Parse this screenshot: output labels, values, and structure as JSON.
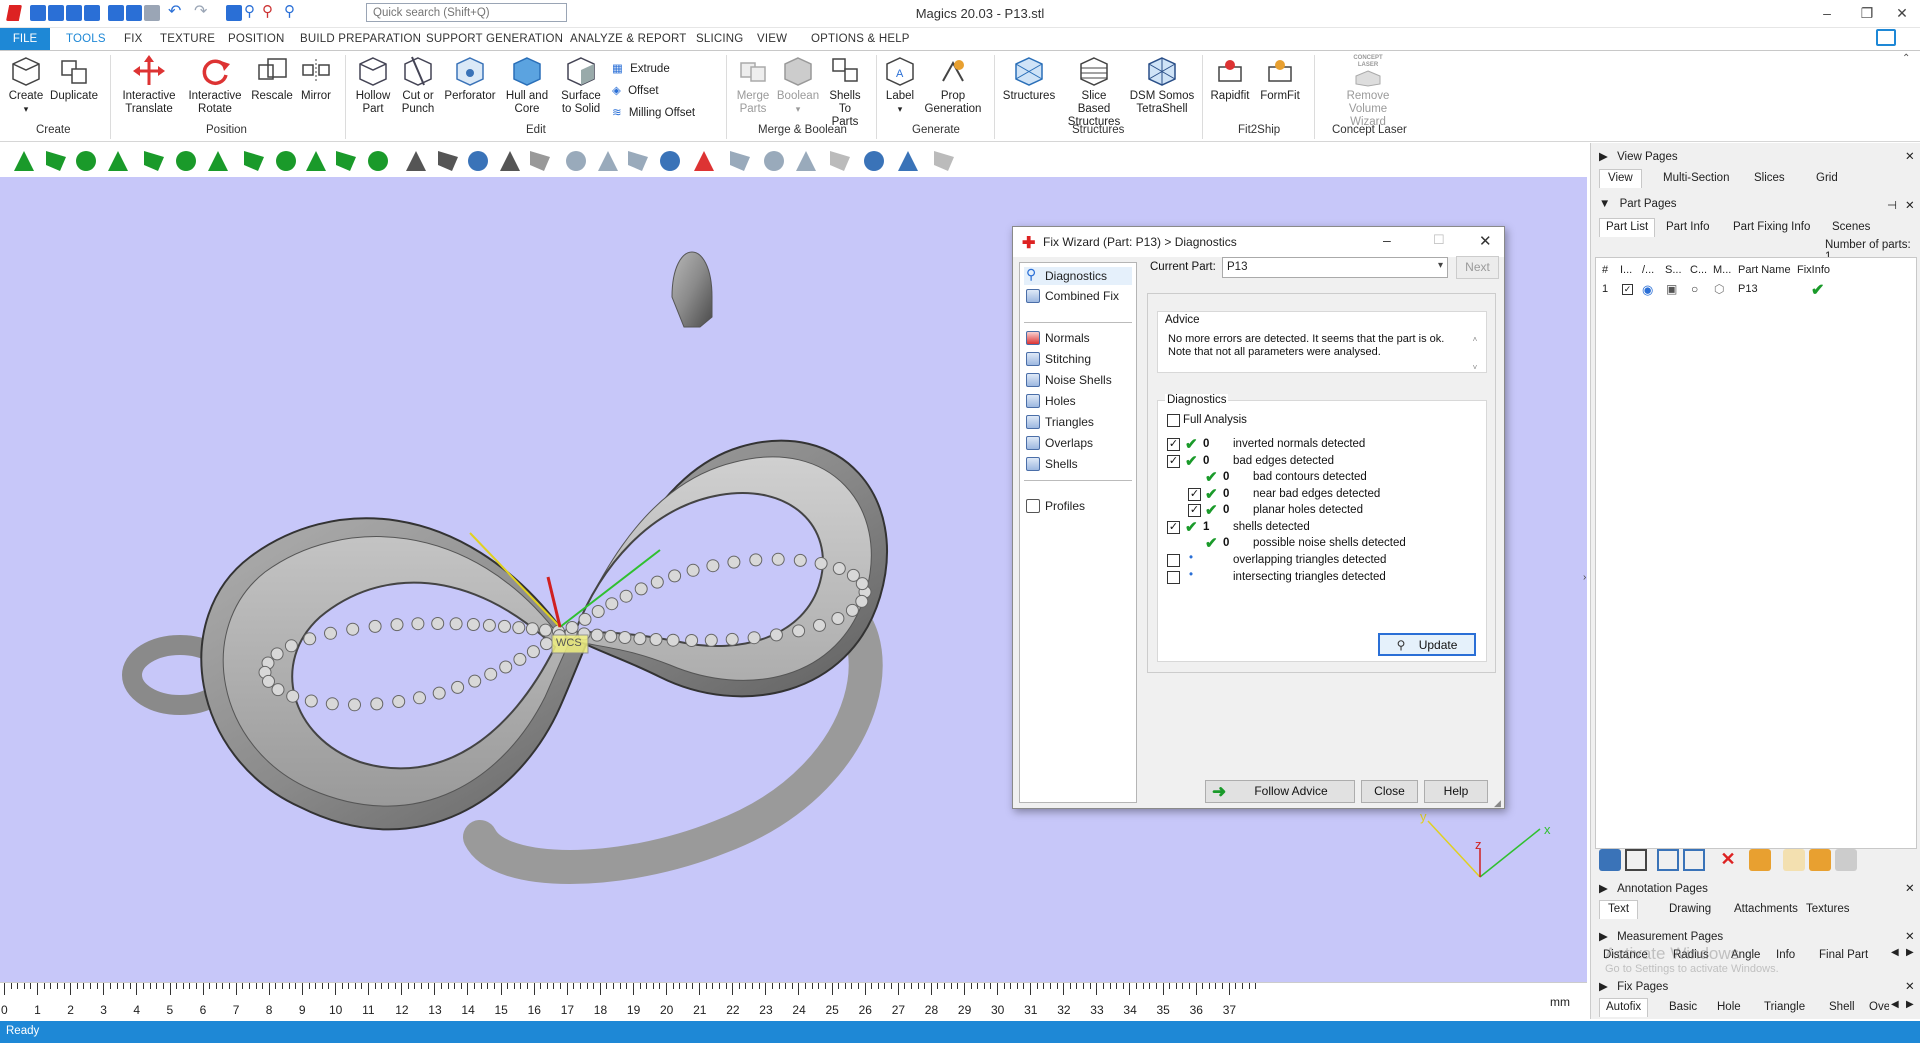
{
  "app": {
    "title": "Magics 20.03 - P13.stl",
    "search_placeholder": "Quick search (Shift+Q)"
  },
  "menu": {
    "tabs": [
      "FILE",
      "TOOLS",
      "FIX",
      "TEXTURE",
      "POSITION",
      "BUILD PREPARATION",
      "SUPPORT GENERATION",
      "ANALYZE & REPORT",
      "SLICING",
      "VIEW",
      "OPTIONS & HELP"
    ]
  },
  "ribbon": {
    "create": {
      "group": "Create",
      "create": "Create",
      "duplicate": "Duplicate"
    },
    "position": {
      "group": "Position",
      "translate": "Interactive Translate",
      "rotate": "Interactive Rotate",
      "rescale": "Rescale",
      "mirror": "Mirror"
    },
    "edit": {
      "group": "Edit",
      "hollow": "Hollow Part",
      "cut": "Cut or Punch",
      "perforator": "Perforator",
      "hull": "Hull and Core",
      "surface": "Surface to Solid",
      "extrude": "Extrude",
      "offset": "Offset",
      "milling": "Milling Offset"
    },
    "merge": {
      "group": "Merge & Boolean",
      "merge": "Merge Parts",
      "boolean": "Boolean",
      "shells": "Shells To Parts"
    },
    "generate": {
      "group": "Generate",
      "label": "Label",
      "prop": "Prop Generation"
    },
    "structures": {
      "group": "Structures",
      "structures": "Structures",
      "slice": "Slice Based Structures",
      "dsm": "DSM Somos TetraShell"
    },
    "fit2ship": {
      "group": "Fit2Ship",
      "rapidfit": "Rapidfit",
      "formfit": "FormFit"
    },
    "concept": {
      "group": "Concept Laser",
      "remove": "Remove Volume Wizard",
      "logo": "CONCEPT LASER"
    }
  },
  "viewport": {
    "wcs_label": "WCS",
    "axes": {
      "x": "x",
      "y": "y",
      "z": "z"
    }
  },
  "ruler": {
    "unit": "mm",
    "labels": [
      "0",
      "1",
      "2",
      "3",
      "4",
      "5",
      "6",
      "7",
      "8",
      "9",
      "10",
      "11",
      "12",
      "13",
      "14",
      "15",
      "16",
      "17",
      "18",
      "19",
      "20",
      "21",
      "22",
      "23",
      "24",
      "25",
      "26",
      "27",
      "28",
      "29",
      "30",
      "31",
      "32",
      "33",
      "34",
      "35",
      "36",
      "37"
    ]
  },
  "status": {
    "text": "Ready"
  },
  "dialog": {
    "title": "Fix Wizard (Part: P13) > Diagnostics",
    "nav": {
      "diagnostics": "Diagnostics",
      "combined_fix": "Combined Fix",
      "normals": "Normals",
      "stitching": "Stitching",
      "noise_shells": "Noise Shells",
      "holes": "Holes",
      "triangles": "Triangles",
      "overlaps": "Overlaps",
      "shells": "Shells",
      "profiles": "Profiles"
    },
    "current_part_label": "Current Part:",
    "current_part_value": "P13",
    "next_label": "Next",
    "advice_label": "Advice",
    "advice_text": "No more errors are detected. It seems that the part is ok. Note that not all parameters were analysed.",
    "diagnostics_label": "Diagnostics",
    "full_analysis": "Full Analysis",
    "rows": [
      {
        "count": "0",
        "text": "inverted normals detected",
        "checked": true,
        "ok": true
      },
      {
        "count": "0",
        "text": "bad edges detected",
        "checked": true,
        "ok": true
      },
      {
        "count": "0",
        "text": "bad contours detected",
        "checked": false,
        "ok": true
      },
      {
        "count": "0",
        "text": "near bad edges detected",
        "checked": true,
        "ok": true
      },
      {
        "count": "0",
        "text": "planar holes detected",
        "checked": true,
        "ok": true
      },
      {
        "count": "1",
        "text": "shells detected",
        "checked": true,
        "ok": true
      },
      {
        "count": "0",
        "text": "possible noise shells detected",
        "checked": false,
        "ok": true
      },
      {
        "count": "",
        "text": "overlapping triangles detected",
        "checked": false,
        "ok": false
      },
      {
        "count": "",
        "text": "intersecting triangles detected",
        "checked": false,
        "ok": false
      }
    ],
    "update_label": "Update",
    "follow_label": "Follow Advice",
    "close_label": "Close",
    "help_label": "Help"
  },
  "rightpanel": {
    "view_pages": "View Pages",
    "view_tabs": [
      "View",
      "Multi-Section",
      "Slices",
      "Grid"
    ],
    "part_pages": "Part Pages",
    "part_tabs": [
      "Part List",
      "Part Info",
      "Part Fixing Info",
      "Scenes"
    ],
    "num_parts": "Number of parts: 1",
    "columns": [
      "#",
      "I...",
      "/...",
      "S...",
      "C...",
      "M...",
      "Part Name",
      "FixInfo"
    ],
    "row": {
      "index": "1",
      "name": "P13"
    },
    "annotation_pages": "Annotation Pages",
    "annotation_tabs": [
      "Text",
      "Drawing",
      "Attachments",
      "Textures"
    ],
    "measurement_pages": "Measurement Pages",
    "measurement_tabs": [
      "Distance",
      "Radius",
      "Angle",
      "Info",
      "Final Part"
    ],
    "fix_pages": "Fix Pages",
    "fix_tabs": [
      "Autofix",
      "Basic",
      "Hole",
      "Triangle",
      "Shell",
      "Over"
    ],
    "watermark1": "Activate Windows",
    "watermark2": "Go to Settings to activate Windows."
  },
  "colors": {
    "accent": "#1e88d6",
    "viewport_bg": "#c7c7f9",
    "check_green": "#1a9a2a"
  }
}
